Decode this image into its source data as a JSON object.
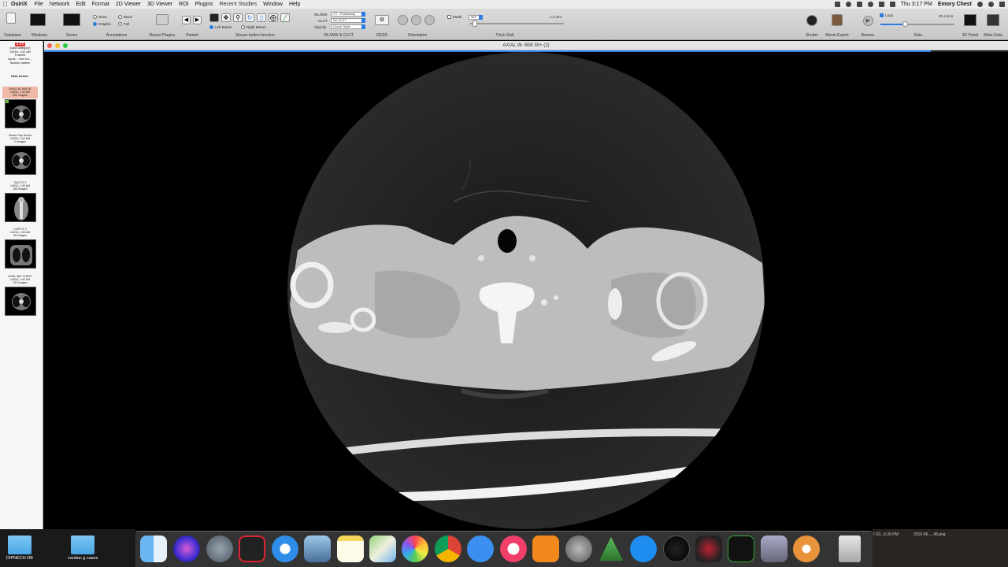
{
  "menubar": {
    "app": "OsiriX",
    "items": [
      "File",
      "Network",
      "Edit",
      "Format",
      "2D Viewer",
      "3D Viewer",
      "ROI",
      "Plugins",
      "Recent Studies",
      "Window",
      "Help"
    ],
    "clock": "Thu 3:17 PM",
    "user": "Emory Chest"
  },
  "toolbar": {
    "labels": {
      "database": "Database",
      "windows": "Windows",
      "series": "Series",
      "annotations": "Annotations",
      "report_plugins": "Report Plugins",
      "patient": "Patient",
      "mouse": "Mouse button function",
      "wlww": "WL/WW & CLUT",
      "twod_3d": "2D/3D",
      "orientation": "Orientation",
      "thick_slab": "Thick Slab",
      "shutter": "Shutter",
      "movie_export": "Movie Export",
      "browse": "Browse",
      "rate": "Rate",
      "threed_panel": "3D Panel",
      "meta_data": "Meta-Data"
    },
    "annotation_options": [
      "None",
      "Basic",
      "Graphic",
      "Full"
    ],
    "mouse_options": [
      "Left Button",
      "Right Button"
    ],
    "wl_select_labels": [
      "WL/WW",
      "CLUT",
      "Opacity"
    ],
    "wl_values": [
      "CT - Pulmonary",
      "No CLUT",
      "Linear Table"
    ],
    "thick_value": "1.2 mm",
    "mode_label": "Mode",
    "mode_value": "MIP",
    "loop_label": "Loop",
    "rate_value": "20.4 im/s"
  },
  "sidebar": {
    "header_badge": "1 CT",
    "header_lines": [
      "(case category)",
      "1/6/16, 1:42 AM",
      "5 series",
      "lupus -- nine lun...",
      "traction pattern"
    ],
    "hide_series": "Hide Series",
    "series": [
      {
        "lines": [
          "AXIAL W- BMI 30",
          "1/6/16, 1:42 AM",
          "202 Images"
        ],
        "active": true
      },
      {
        "lines": [
          "Smart Prep Series",
          "1/6/16, 1:44 AM",
          "2 Images"
        ],
        "active": false
      },
      {
        "lines": [
          "SAG ST 2",
          "1/6/16, 1:45 AM",
          "165 Images"
        ],
        "active": false
      },
      {
        "lines": [
          "COR ST 2",
          "1/6/16, 1:45 AM",
          "95 Images"
        ],
        "active": false
      },
      {
        "lines": [
          "AXIAL MIP CHEST",
          "1/6/16, 1:42 AM",
          "102 Images"
        ],
        "active": false
      }
    ]
  },
  "viewer": {
    "title": "AXIAL W- BMI 30+ (2)",
    "slice_progress": 0.92
  },
  "desktop": {
    "files": [
      "DIPNECH DB",
      "cardiac g cases"
    ],
    "right_labels": [
      "7-03...0.26 PM",
      "2016-06..._48.png"
    ]
  },
  "dock": {
    "icons": [
      "finder-icon",
      "siri-icon",
      "launchpad-icon",
      "photo-booth-icon",
      "safari-icon",
      "preview-icon",
      "notes-icon",
      "maps-icon",
      "photos-icon",
      "chrome-icon",
      "messages-icon",
      "itunes-icon",
      "ibooks-icon",
      "system-preferences-icon",
      "pyramid-app-icon",
      "app-store-icon",
      "dashboard-icon",
      "osirix-icon",
      "activity-monitor-icon",
      "image-capture-icon",
      "flower-app-icon",
      "trash-icon"
    ]
  }
}
